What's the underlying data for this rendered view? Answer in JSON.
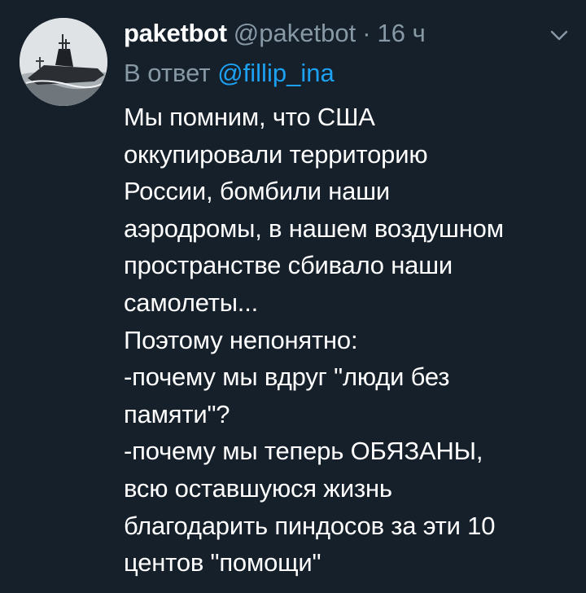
{
  "tweet": {
    "display_name": "paketbot",
    "handle": "@paketbot",
    "separator": "·",
    "timestamp": "16 ч",
    "reply_prefix": "В ответ",
    "reply_to": "@fillip_ina",
    "lines": [
      "Мы помним, что США",
      "оккупировали территорию",
      "России, бомбили наши",
      "аэродромы, в нашем воздушном",
      "пространстве сбивало наши",
      "самолеты...",
      "Поэтому непонятно:",
      "-почему мы вдруг \"люди без",
      "памяти\"?",
      "-почему мы теперь ОБЯЗАНЫ,",
      "всю оставшуюся жизнь",
      "благодарить пиндосов за эти 10",
      "центов \"помощи\""
    ]
  },
  "icons": {
    "avatar": "submarine-avatar",
    "menu": "chevron-down-icon"
  },
  "colors": {
    "background": "#15202b",
    "text_primary": "#ffffff",
    "text_secondary": "#8899a6",
    "link": "#1da1f2"
  }
}
